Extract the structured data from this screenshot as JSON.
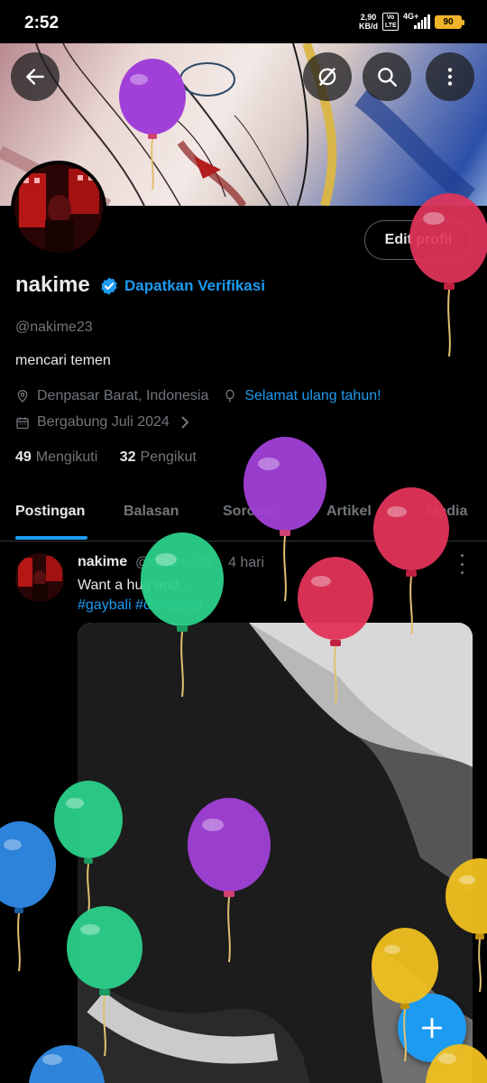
{
  "status_bar": {
    "time": "2:52",
    "net_speed_value": "2,90",
    "net_speed_unit": "KB/d",
    "volte": "Vo LTE",
    "network": "4G+",
    "battery": "90"
  },
  "header": {
    "back_icon": "arrow-left-icon",
    "grok_icon": "grok-icon",
    "search_icon": "search-icon",
    "more_icon": "more-vertical-icon"
  },
  "profile": {
    "name": "nakime",
    "verify_link": "Dapatkan Verifikasi",
    "handle": "@nakime23",
    "bio": "mencari temen",
    "location": "Denpasar Barat, Indonesia",
    "birthday": "Selamat ulang tahun!",
    "joined": "Bergabung Juli 2024",
    "following_count": "49",
    "following_label": "Mengikuti",
    "followers_count": "32",
    "followers_label": "Pengikut",
    "edit_button": "Edit profil"
  },
  "tabs": [
    "Postingan",
    "Balasan",
    "Sorotan",
    "Artikel",
    "Media"
  ],
  "post": {
    "name": "nakime",
    "handle": "@nakime23",
    "time": "4 hari",
    "text": "Want a hug and...",
    "tags": "#gaybali #denpasar"
  },
  "colors": {
    "accent": "#1d9bf0",
    "background": "#000000",
    "muted": "#71767b"
  }
}
